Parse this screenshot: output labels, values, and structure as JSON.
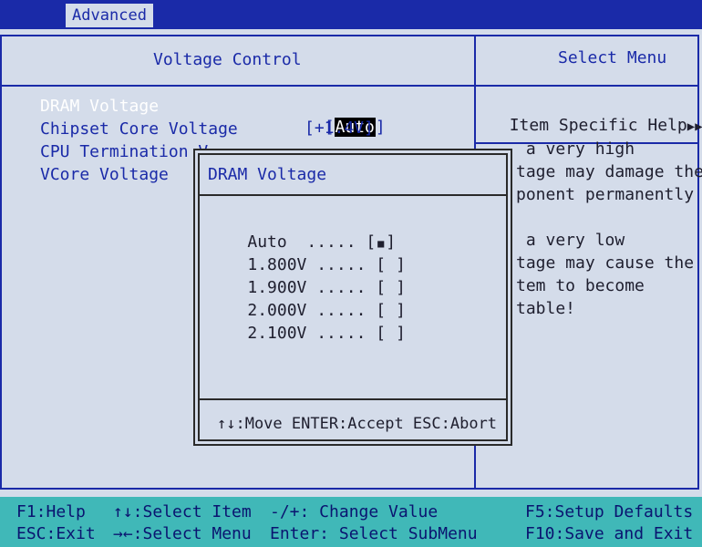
{
  "top_tab": {
    "label": "Advanced"
  },
  "left_panel": {
    "title": "Voltage Control",
    "items": [
      {
        "label": "DRAM Voltage",
        "value_open": "[",
        "value": "Auto",
        "value_close": "]"
      },
      {
        "label": "Chipset Core Voltage",
        "value": "[+1.4V]"
      },
      {
        "label": "CPU Termination V"
      },
      {
        "label": "VCore Voltage"
      }
    ]
  },
  "right_panel": {
    "title": "Select Menu",
    "help_title": "Item Specific Help",
    "help_arrows": "▶▶▶",
    "help_lines": [
      " a very high",
      "tage may damage the",
      "ponent permanently",
      " a very low",
      "tage may cause the",
      "tem to become",
      "table!"
    ]
  },
  "popup": {
    "title": "DRAM Voltage",
    "options": [
      {
        "label": "Auto  ..... [",
        "mark": "■",
        "close": "]"
      },
      {
        "label": "1.800V ..... [",
        "mark": " ",
        "close": "]"
      },
      {
        "label": "1.900V ..... [",
        "mark": " ",
        "close": "]"
      },
      {
        "label": "2.000V ..... [",
        "mark": " ",
        "close": "]"
      },
      {
        "label": "2.100V ..... [",
        "mark": " ",
        "close": "]"
      }
    ],
    "footer": "↑↓:Move ENTER:Accept ESC:Abort"
  },
  "status_bar": {
    "f1": "F1:Help",
    "esc": "ESC:Exit",
    "updown": "↑↓:Select Item",
    "leftright": "→←:Select Menu",
    "change": "-/+: Change Value",
    "enter": "Enter: Select SubMenu",
    "f5": "F5:Setup Defaults",
    "f10": "F10:Save and Exit"
  },
  "colors": {
    "bios_blue": "#1a2aa8",
    "background": "#d4dcea",
    "status_bar": "#40b8b8"
  }
}
